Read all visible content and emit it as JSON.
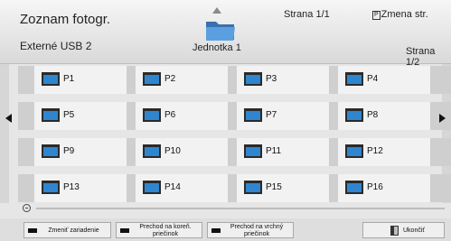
{
  "header": {
    "title": "Zoznam fotogr.",
    "device": "Externé USB 2",
    "page_top": "Strana 1/1",
    "page_switch_label": "Zmena str.",
    "page_switch_badge": "P",
    "page_right": "Strana 1/2",
    "current_folder": "Jednotka 1"
  },
  "grid": {
    "rows": [
      [
        "P1",
        "P2",
        "P3",
        "P4"
      ],
      [
        "P5",
        "P6",
        "P7",
        "P8"
      ],
      [
        "P9",
        "P10",
        "P11",
        "P12"
      ],
      [
        "P13",
        "P14",
        "P15",
        "P16"
      ]
    ]
  },
  "footer": {
    "change_device": "Zmeniť zariadenie",
    "go_root_line1": "Prechod na koreň.",
    "go_root_line2": "priečinok",
    "go_up_line1": "Prechod na vrchný",
    "go_up_line2": "priečinok",
    "exit": "Ukončiť"
  },
  "colors": {
    "folder_blue": "#2f86cf",
    "folder_dark": "#2a2a2a"
  }
}
